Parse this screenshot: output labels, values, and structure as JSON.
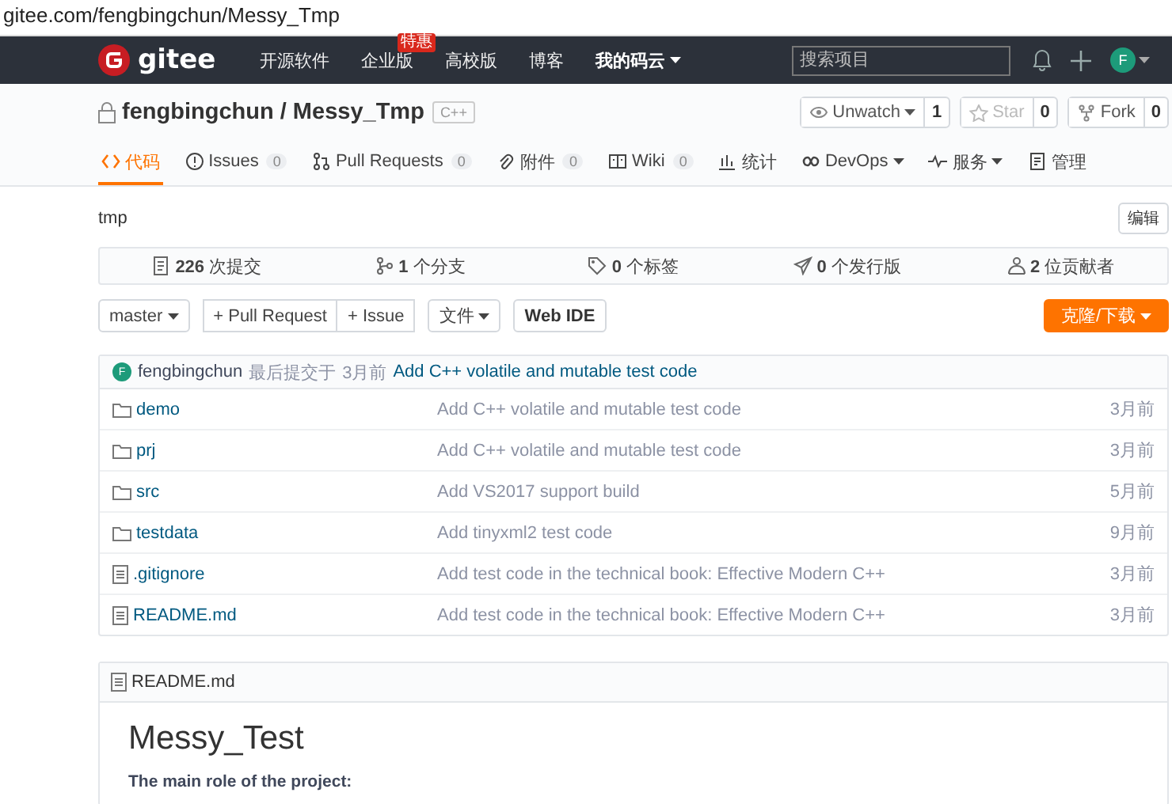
{
  "address_bar": {
    "url": "gitee.com/fengbingchun/Messy_Tmp"
  },
  "navbar": {
    "logo": "gitee",
    "items": [
      {
        "label": "开源软件",
        "dropdown": false
      },
      {
        "label": "企业版",
        "badge": "特惠",
        "dropdown": false
      },
      {
        "label": "高校版",
        "dropdown": false
      },
      {
        "label": "博客",
        "dropdown": false
      },
      {
        "label": "我的码云",
        "dropdown": true
      }
    ],
    "search": {
      "placeholder": "搜索项目"
    },
    "avatar": "F"
  },
  "repo": {
    "title": "fengbingchun / Messy_Tmp",
    "language": "C++",
    "private": true,
    "actions": [
      {
        "label": "Unwatch",
        "count": "1",
        "dropdown": true,
        "disabled": false
      },
      {
        "label": "Star",
        "count": "0",
        "dropdown": false,
        "disabled": true
      },
      {
        "label": "Fork",
        "count": "0",
        "dropdown": false,
        "disabled": false
      }
    ]
  },
  "tabs": [
    {
      "label": "代码",
      "dropdown": false,
      "selected": true
    },
    {
      "label": "Issues",
      "count": "0",
      "dropdown": false,
      "selected": false
    },
    {
      "label": "Pull Requests",
      "count": "0",
      "dropdown": false,
      "selected": false
    },
    {
      "label": "附件",
      "count": "0",
      "dropdown": false,
      "selected": false
    },
    {
      "label": "Wiki",
      "count": "0",
      "dropdown": false,
      "selected": false
    },
    {
      "label": "统计",
      "dropdown": false,
      "selected": false
    },
    {
      "label": "DevOps",
      "dropdown": true,
      "selected": false
    },
    {
      "label": "服务",
      "dropdown": true,
      "selected": false
    },
    {
      "label": "管理",
      "dropdown": false,
      "selected": false
    }
  ],
  "description": "tmp",
  "edit_button": "编辑",
  "stats": [
    "**226** 次提交",
    "**1** 个分支",
    "**0** 个标签",
    "**0** 个发行版",
    "**2** 位贡献者"
  ],
  "toolbar": {
    "branch": "master",
    "group": [
      "+ Pull Request",
      "+ Issue"
    ],
    "file_menu": "文件",
    "web_ide": "Web IDE",
    "clone": "克隆/下载"
  },
  "last_commit": {
    "avatar": "F",
    "author": "fengbingchun",
    "label": "最后提交于",
    "time": "3月前",
    "message": "Add C++ volatile and mutable test code"
  },
  "files": [
    {
      "kind": "folder",
      "name": "demo",
      "message": "Add C++ volatile and mutable test code",
      "time": "3月前"
    },
    {
      "kind": "folder",
      "name": "prj",
      "message": "Add C++ volatile and mutable test code",
      "time": "3月前"
    },
    {
      "kind": "folder",
      "name": "src",
      "message": "Add VS2017 support build",
      "time": "5月前"
    },
    {
      "kind": "folder",
      "name": "testdata",
      "message": "Add tinyxml2 test code",
      "time": "9月前"
    },
    {
      "kind": "file",
      "name": ".gitignore",
      "message": "Add test code in the technical book: Effective Modern C++",
      "time": "3月前"
    },
    {
      "kind": "file",
      "name": "README.md",
      "message": "Add test code in the technical book: Effective Modern C++",
      "time": "3月前"
    }
  ],
  "readme": {
    "filename": "README.md",
    "heading": "Messy_Test",
    "subheading": "The main role of the project:"
  }
}
